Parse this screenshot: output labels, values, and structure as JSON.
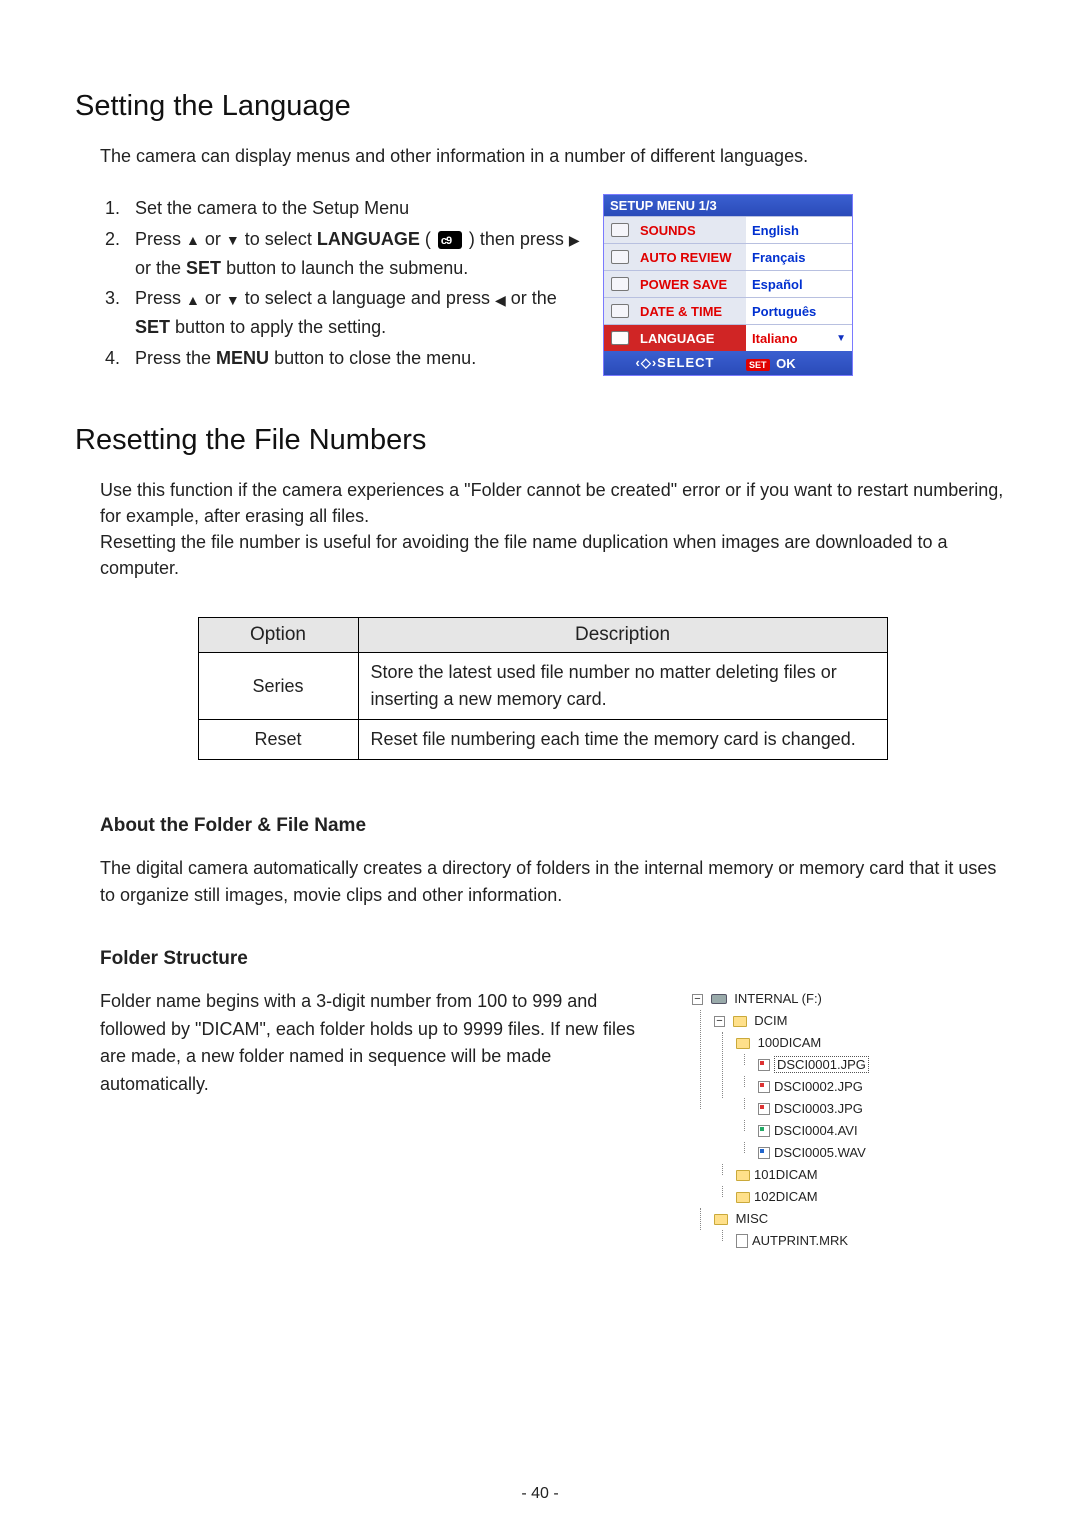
{
  "section_language": {
    "title": "Setting the Language",
    "intro": "The camera can display menus and other information in a number of different languages.",
    "steps": {
      "s1": "Set the camera to the Setup Menu",
      "s2_a": "Press ",
      "s2_b": " or ",
      "s2_c": " to select ",
      "s2_lang": "LANGUAGE",
      "s2_d": " (",
      "s2_e": ") then press ",
      "s2_f": " or the ",
      "s2_set": "SET",
      "s2_g": " button to launch the submenu.",
      "s3_a": "Press ",
      "s3_b": " or ",
      "s3_c": " to select a language and press ",
      "s3_d": " or the ",
      "s3_set": "SET",
      "s3_e": " button to apply the setting.",
      "s4_a": "Press the ",
      "s4_menu": "MENU",
      "s4_b": " button to close the menu."
    }
  },
  "setup_menu": {
    "header": "SETUP MENU 1/3",
    "rows": [
      {
        "label": "SOUNDS",
        "value": "English"
      },
      {
        "label": "AUTO REVIEW",
        "value": "Français"
      },
      {
        "label": "POWER SAVE",
        "value": "Español"
      },
      {
        "label": "DATE & TIME",
        "value": "Português"
      },
      {
        "label": "LANGUAGE",
        "value": "Italiano",
        "selected": true
      }
    ],
    "footer_left": "SELECT",
    "footer_set": "SET",
    "footer_ok": "OK"
  },
  "section_reset": {
    "title": "Resetting the File Numbers",
    "p1": "Use this function if the camera experiences a \"Folder cannot be created\" error or if you want to restart numbering, for example, after erasing all files.",
    "p2": "Resetting the file number is useful for avoiding the file name duplication when images are downloaded to a computer.",
    "table": {
      "h_option": "Option",
      "h_desc": "Description",
      "r1_opt": "Series",
      "r1_desc": "Store the latest used file number no matter deleting files or inserting a new memory card.",
      "r2_opt": "Reset",
      "r2_desc": "Reset file numbering each time the memory card is changed."
    }
  },
  "about_folder": {
    "h": "About the Folder & File Name",
    "p": "The digital camera automatically creates a directory of folders in the internal memory or memory card that it uses to organize still images, movie clips and other information."
  },
  "folder_structure": {
    "h": "Folder Structure",
    "p": "Folder name begins with a 3-digit number from 100 to 999 and followed by \"DICAM\", each folder holds up to 9999 files. If new files are made, a new folder named in sequence will be made automatically.",
    "tree": {
      "root": "INTERNAL (F:)",
      "dcim": "DCIM",
      "f100": "100DICAM",
      "files": [
        "DSCI0001.JPG",
        "DSCI0002.JPG",
        "DSCI0003.JPG",
        "DSCI0004.AVI",
        "DSCI0005.WAV"
      ],
      "f101": "101DICAM",
      "f102": "102DICAM",
      "misc": "MISC",
      "aut": "AUTPRINT.MRK"
    }
  },
  "page_number": "- 40 -"
}
